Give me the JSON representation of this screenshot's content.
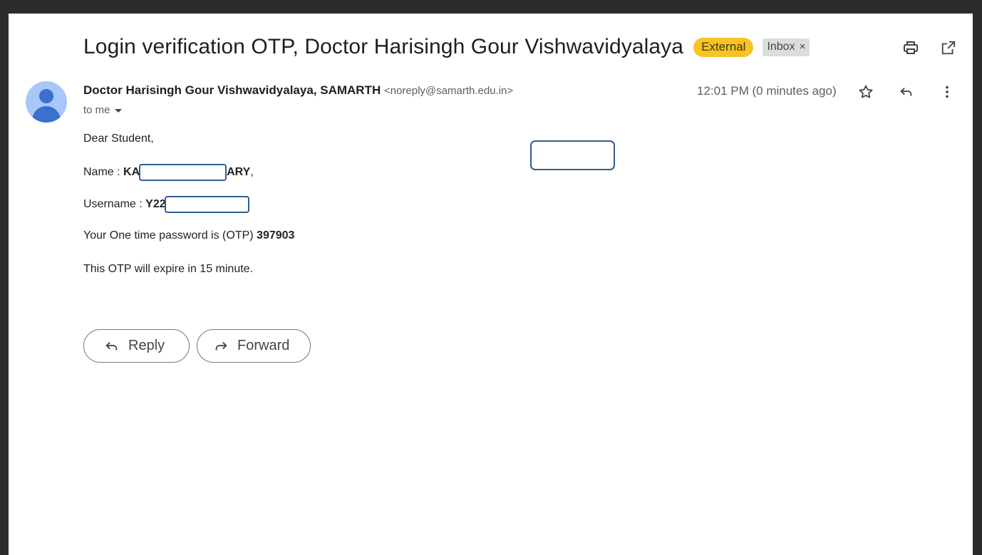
{
  "email": {
    "subject": "Login verification OTP, Doctor Harisingh Gour Vishwavidyalaya",
    "labels": {
      "external": "External",
      "inbox": "Inbox",
      "inbox_remove": "×"
    },
    "sender": {
      "name": "Doctor Harisingh Gour Vishwavidyalaya, SAMARTH",
      "email": "<noreply@samarth.edu.in>"
    },
    "recipient_label": "to me",
    "timestamp": "12:01 PM (0 minutes ago)",
    "body": {
      "greeting": "Dear Student,",
      "name_label": "Name : ",
      "name_prefix": "KA",
      "name_suffix": "ARY",
      "name_trailing": ",",
      "username_label": "Username : ",
      "username_prefix": "Y22",
      "otp_label": "Your One time password is (OTP) ",
      "otp_value": "397903",
      "expiry": "This OTP will expire in 15 minute."
    },
    "actions": {
      "reply": "Reply",
      "forward": "Forward"
    }
  },
  "icons": {
    "print": "print-icon",
    "open_new_window": "open-in-new-icon",
    "star": "star-icon",
    "reply": "reply-icon",
    "more": "more-vert-icon",
    "avatar": "person-icon"
  },
  "colors": {
    "external_badge": "#f7c325",
    "inbox_badge": "#dcdcdc",
    "avatar_bg": "#a8c7fa",
    "avatar_fg": "#3b6fd0",
    "redaction_border": "#2f5f92"
  }
}
